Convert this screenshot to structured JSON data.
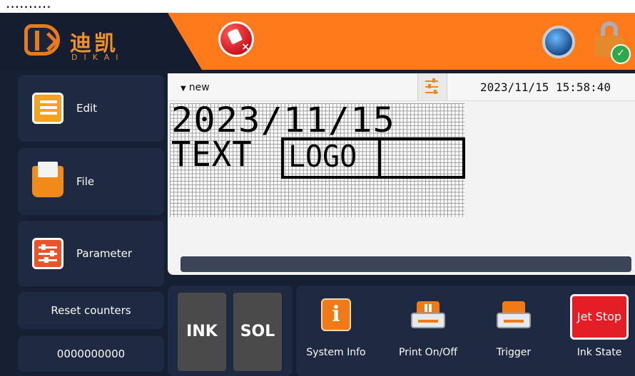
{
  "caption": "..........",
  "header": {
    "brand_cn": "迪凯",
    "brand_en": "DIKAI"
  },
  "sidebar": {
    "items": [
      {
        "label": "Edit",
        "icon": "edit-icon"
      },
      {
        "label": "File",
        "icon": "folder-icon"
      },
      {
        "label": "Parameter",
        "icon": "parameter-icon"
      }
    ],
    "reset_label": "Reset counters",
    "counter_value": "0000000000"
  },
  "editor": {
    "document_name": "new",
    "datetime": "2023/11/15 15:58:40",
    "line1": "2023/11/15",
    "line2_text": "TEXT",
    "logo_text": "LOGO"
  },
  "ink_panel": {
    "ink_label": "INK",
    "sol_label": "SOL"
  },
  "actions": [
    {
      "label": "System Info",
      "icon": "info-icon"
    },
    {
      "label": "Print On/Off",
      "icon": "print-toggle-icon"
    },
    {
      "label": "Trigger",
      "icon": "printer-icon"
    },
    {
      "label": "Ink State",
      "icon": "jet-stop-icon",
      "badge": "Jet Stop"
    }
  ],
  "colors": {
    "accent": "#ff7a1a",
    "background": "#172033",
    "panel": "#1e2942",
    "jet_stop": "#e31e26"
  }
}
